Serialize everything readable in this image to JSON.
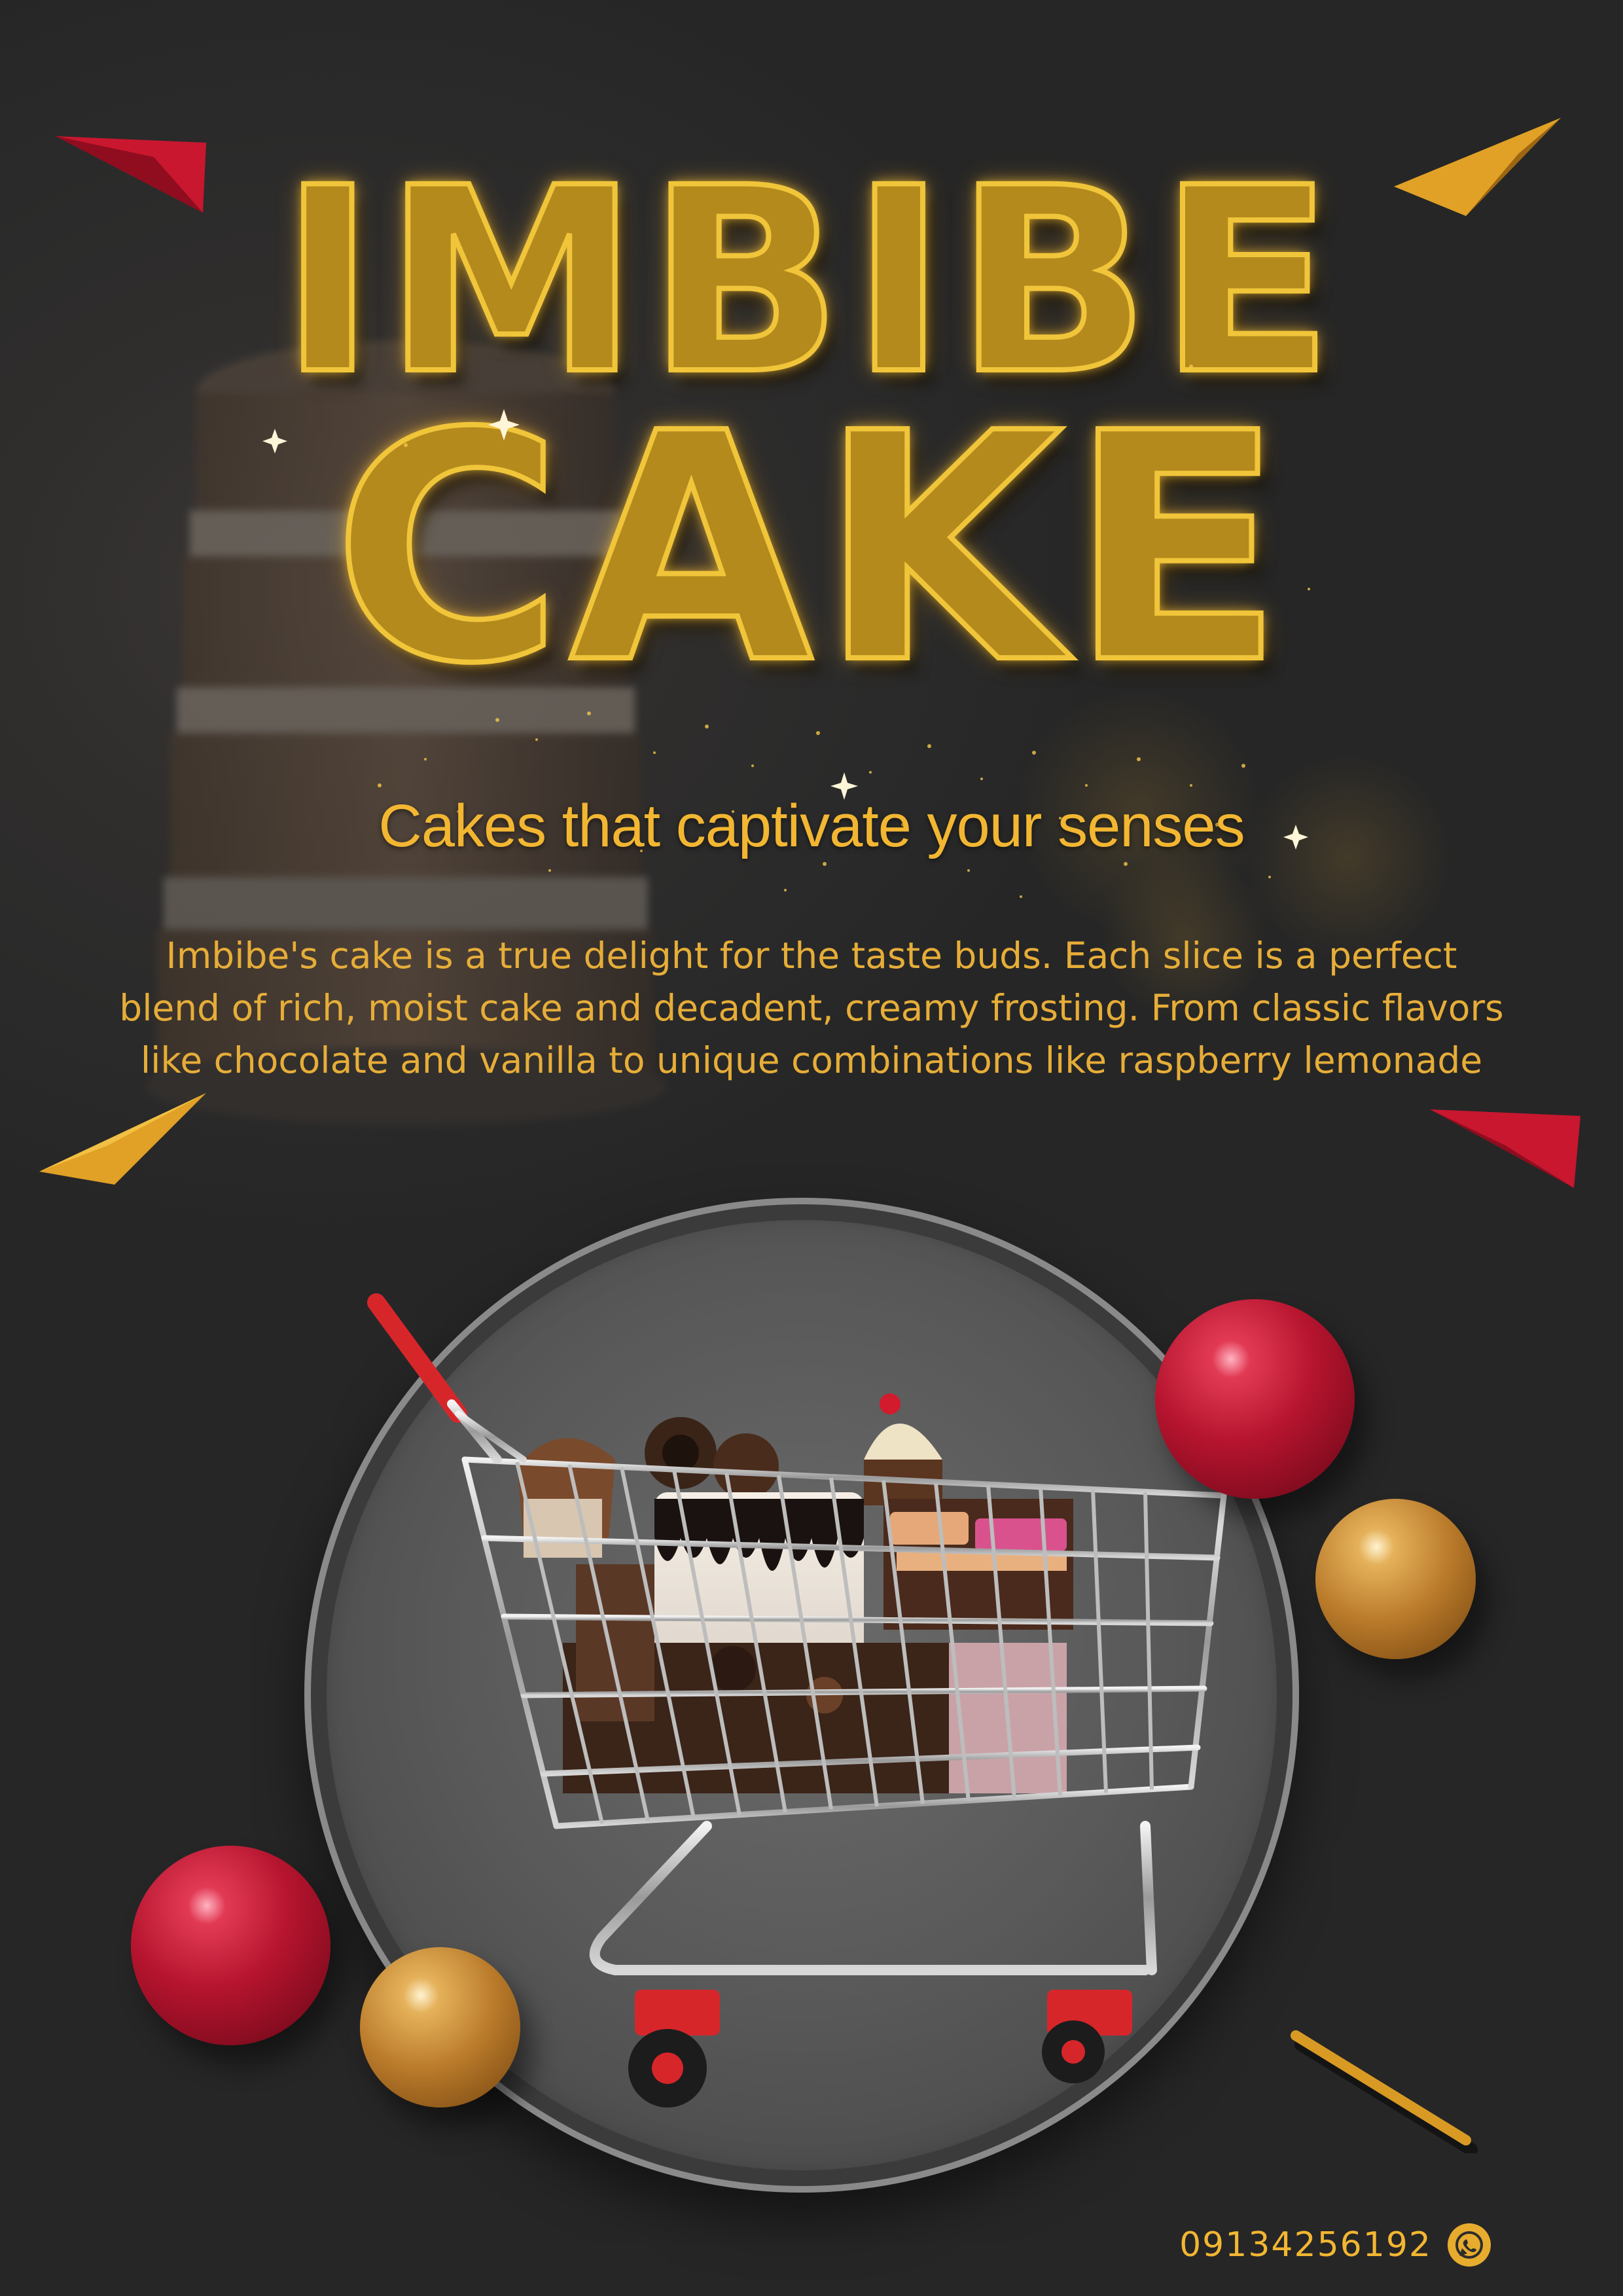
{
  "title": {
    "line1": "IMBIBE",
    "line2": "CAKE"
  },
  "tagline": "Cakes that captivate your senses",
  "description": {
    "lines": [
      "Imbibe's cake is a true delight for the taste buds. Each slice is a perfect",
      "blend of rich, moist cake and decadent, creamy frosting. From classic flavors",
      "like chocolate and vanilla to unique combinations like raspberry lemonade"
    ]
  },
  "contact": {
    "phone": "09134256192",
    "icon": "whatsapp-icon"
  },
  "illustration": {
    "main": "shopping-cart-full-of-cakes",
    "decorations": [
      "red-ball",
      "gold-ball",
      "red-triangle",
      "gold-triangle",
      "gold-stick"
    ]
  },
  "colors": {
    "background": "#2d2d2d",
    "gold": "#f2b632",
    "title_fill": "#b48a1c",
    "title_outline": "#f1c53a",
    "red": "#b5142e"
  }
}
